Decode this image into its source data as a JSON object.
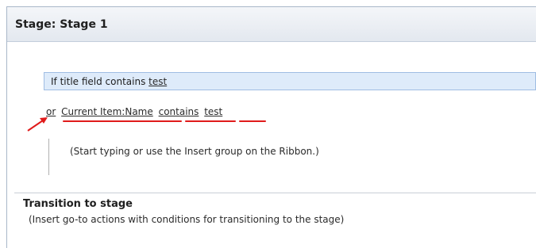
{
  "stage": {
    "title": "Stage: Stage 1"
  },
  "condition": {
    "prefix": "If title field contains ",
    "value": "test"
  },
  "or_condition": {
    "connector": "or",
    "field": "Current Item:Name",
    "operator": "contains",
    "value": "test"
  },
  "insert_hint": "(Start typing or use the Insert group on the Ribbon.)",
  "transition": {
    "title": "Transition to stage",
    "hint": "(Insert go-to actions with conditions for transitioning to the stage)"
  },
  "colors": {
    "highlight_underline": "#e01b1b",
    "condition_bg": "#deebfa"
  }
}
